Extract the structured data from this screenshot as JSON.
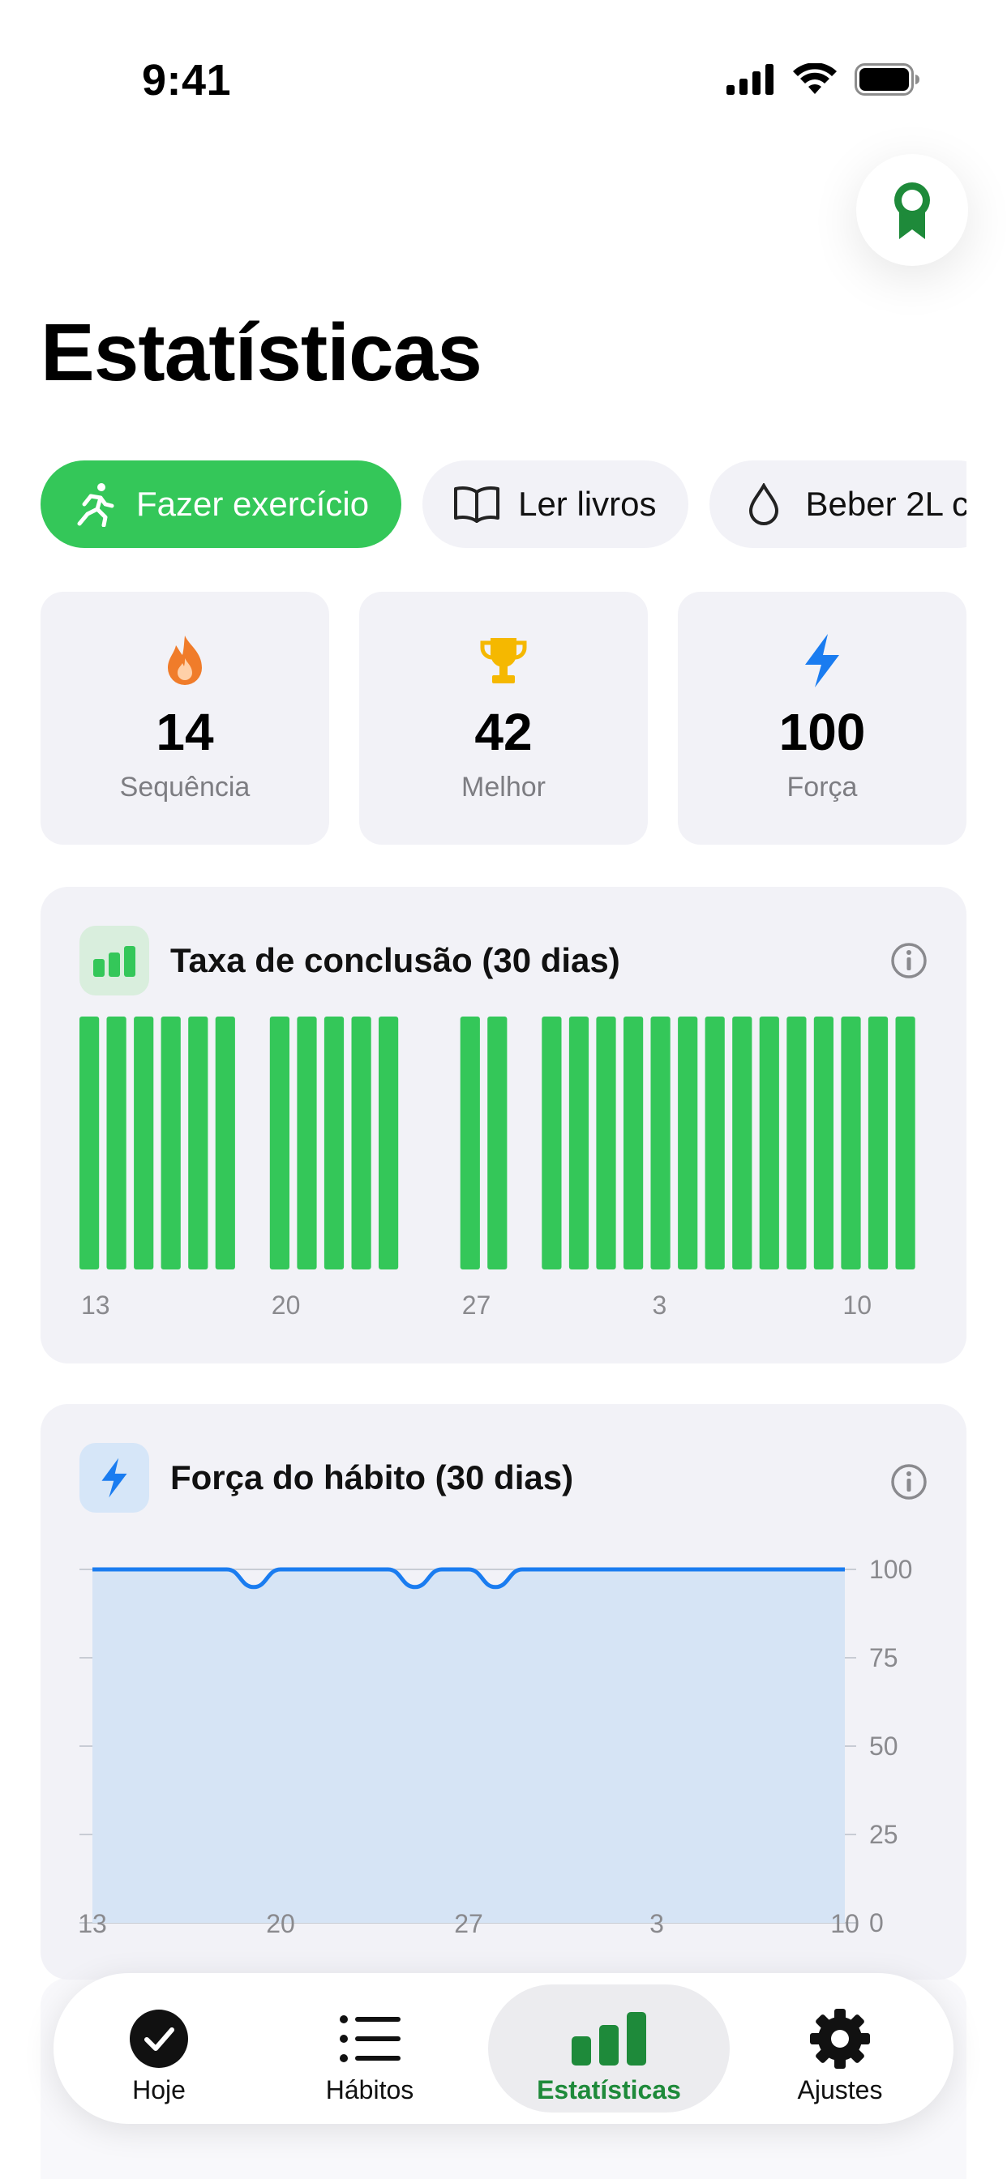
{
  "status": {
    "time": "9:41"
  },
  "page": {
    "title": "Estatísticas"
  },
  "chips": [
    {
      "label": "Fazer exercício",
      "icon": "running-person-icon",
      "active": true
    },
    {
      "label": "Ler livros",
      "icon": "open-book-icon",
      "active": false
    },
    {
      "label": "Beber 2L c",
      "icon": "water-drop-icon",
      "active": false
    }
  ],
  "stats": [
    {
      "value": "14",
      "label": "Sequência",
      "icon": "flame-icon",
      "color": "#f07c2a"
    },
    {
      "value": "42",
      "label": "Melhor",
      "icon": "trophy-icon",
      "color": "#f5b800"
    },
    {
      "value": "100",
      "label": "Força",
      "icon": "bolt-icon",
      "color": "#1a7cf0"
    }
  ],
  "completion": {
    "title": "Taxa de conclusão (30 dias)",
    "x_ticks": [
      "13",
      "20",
      "27",
      "3",
      "10"
    ]
  },
  "strength": {
    "title": "Força do hábito (30 dias)",
    "x_ticks": [
      "13",
      "20",
      "27",
      "3",
      "10"
    ],
    "y_ticks": [
      "100",
      "75",
      "50",
      "25",
      "0"
    ]
  },
  "tabs": [
    {
      "label": "Hoje",
      "icon": "checkmark-circle-icon",
      "active": false
    },
    {
      "label": "Hábitos",
      "icon": "list-icon",
      "active": false
    },
    {
      "label": "Estatísticas",
      "icon": "bar-chart-icon",
      "active": true
    },
    {
      "label": "Ajustes",
      "icon": "gear-icon",
      "active": false
    }
  ],
  "colors": {
    "accent": "#34c759",
    "accent_dark": "#1e8a3a",
    "blue": "#1a7cf0",
    "card_bg": "#f2f2f7"
  },
  "chart_data": [
    {
      "type": "bar",
      "title": "Taxa de conclusão (30 dias)",
      "x": [
        "13",
        "14",
        "15",
        "16",
        "17",
        "18",
        "19",
        "20",
        "21",
        "22",
        "23",
        "24",
        "25",
        "26",
        "27",
        "28",
        "29",
        "30",
        "31",
        "1",
        "2",
        "3",
        "4",
        "5",
        "6",
        "7",
        "8",
        "9",
        "10",
        "11",
        "12"
      ],
      "values": [
        1,
        1,
        1,
        1,
        1,
        1,
        0,
        1,
        1,
        1,
        1,
        1,
        0,
        0,
        1,
        1,
        0,
        1,
        1,
        1,
        1,
        1,
        1,
        1,
        1,
        1,
        1,
        1,
        1,
        1,
        1
      ],
      "x_ticks": [
        "13",
        "20",
        "27",
        "3",
        "10"
      ],
      "ylim": [
        0,
        1
      ]
    },
    {
      "type": "area",
      "title": "Força do hábito (30 dias)",
      "x": [
        "13",
        "14",
        "15",
        "16",
        "17",
        "18",
        "19",
        "20",
        "21",
        "22",
        "23",
        "24",
        "25",
        "26",
        "27",
        "28",
        "29",
        "30",
        "31",
        "1",
        "2",
        "3",
        "4",
        "5",
        "6",
        "7",
        "8",
        "9",
        "10"
      ],
      "values": [
        100,
        100,
        100,
        100,
        100,
        100,
        95,
        100,
        100,
        100,
        100,
        100,
        95,
        100,
        100,
        95,
        100,
        100,
        100,
        100,
        100,
        100,
        100,
        100,
        100,
        100,
        100,
        100,
        100
      ],
      "x_ticks": [
        "13",
        "20",
        "27",
        "3",
        "10"
      ],
      "y_ticks": [
        100,
        75,
        50,
        25,
        0
      ],
      "ylim": [
        0,
        100
      ],
      "grid": true
    }
  ]
}
